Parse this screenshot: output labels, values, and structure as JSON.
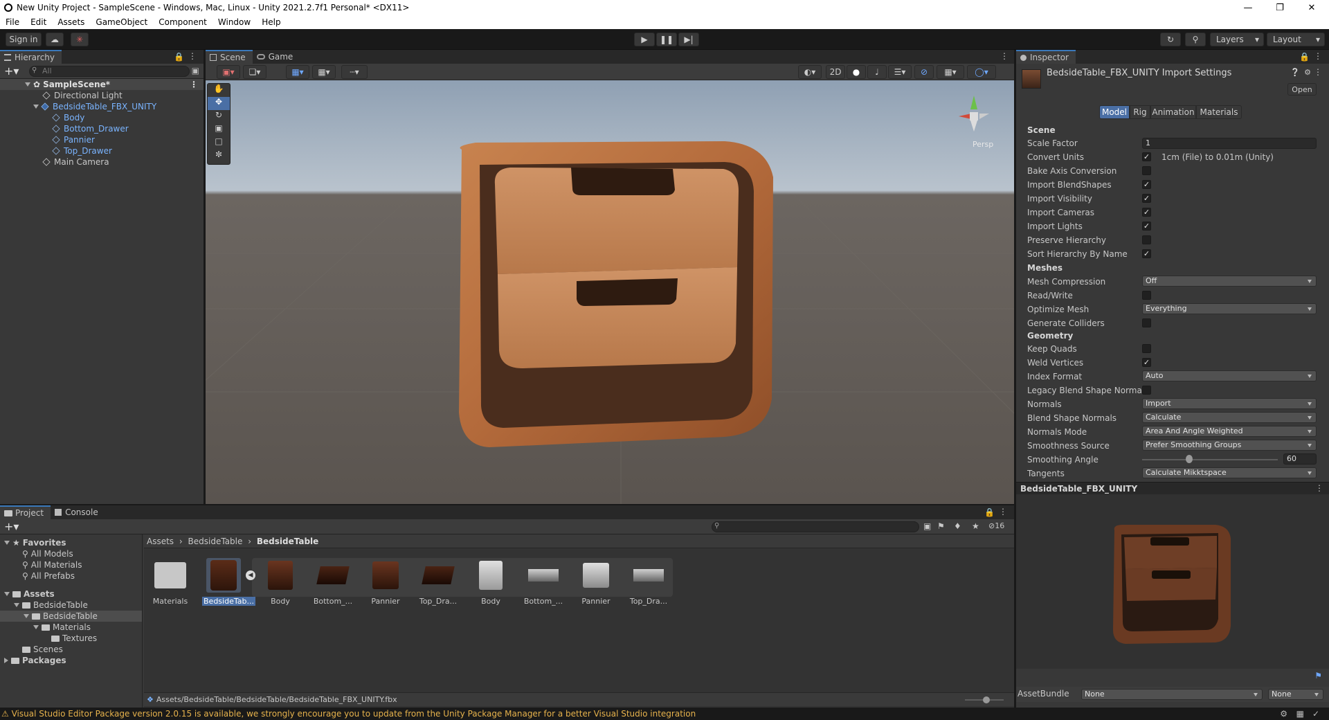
{
  "window": {
    "title": "New Unity Project - SampleScene - Windows, Mac, Linux - Unity 2021.2.7f1 Personal* <DX11>"
  },
  "menu": [
    "File",
    "Edit",
    "Assets",
    "GameObject",
    "Component",
    "Window",
    "Help"
  ],
  "toolbar": {
    "sign_in": "Sign in",
    "layers": "Layers",
    "layout": "Layout"
  },
  "hierarchy": {
    "tab": "Hierarchy",
    "search_placeholder": "All",
    "items": [
      "SampleScene*",
      "Directional Light",
      "BedsideTable_FBX_UNITY",
      "Body",
      "Bottom_Drawer",
      "Pannier",
      "Top_Drawer",
      "Main Camera"
    ]
  },
  "scene": {
    "tab_scene": "Scene",
    "tab_game": "Game",
    "btn_2d": "2D",
    "persp": "Persp"
  },
  "inspector": {
    "tab": "Inspector",
    "title": "BedsideTable_FBX_UNITY Import Settings",
    "open": "Open",
    "tabs": [
      "Model",
      "Rig",
      "Animation",
      "Materials"
    ],
    "scene_header": "Scene",
    "scale_factor_label": "Scale Factor",
    "scale_factor_value": "1",
    "convert_units_label": "Convert Units",
    "convert_units_note": "1cm (File) to 0.01m (Unity)",
    "bake_axis": "Bake Axis Conversion",
    "import_blendshapes": "Import BlendShapes",
    "import_visibility": "Import Visibility",
    "import_cameras": "Import Cameras",
    "import_lights": "Import Lights",
    "preserve_hierarchy": "Preserve Hierarchy",
    "sort_hierarchy": "Sort Hierarchy By Name",
    "meshes_header": "Meshes",
    "mesh_compression_label": "Mesh Compression",
    "mesh_compression_value": "Off",
    "read_write": "Read/Write",
    "optimize_mesh_label": "Optimize Mesh",
    "optimize_mesh_value": "Everything",
    "generate_colliders": "Generate Colliders",
    "geometry_header": "Geometry",
    "keep_quads": "Keep Quads",
    "weld_vertices": "Weld Vertices",
    "index_format_label": "Index Format",
    "index_format_value": "Auto",
    "legacy_blend": "Legacy Blend Shape Normals",
    "normals_label": "Normals",
    "normals_value": "Import",
    "blend_normals_label": "Blend Shape Normals",
    "blend_normals_value": "Calculate",
    "normals_mode_label": "Normals Mode",
    "normals_mode_value": "Area And Angle Weighted",
    "smoothness_source_label": "Smoothness Source",
    "smoothness_source_value": "Prefer Smoothing Groups",
    "smoothing_angle_label": "Smoothing Angle",
    "smoothing_angle_value": "60",
    "tangents_label": "Tangents",
    "tangents_value": "Calculate Mikktspace",
    "preview_title": "BedsideTable_FBX_UNITY",
    "assetbundle_label": "AssetBundle",
    "assetbundle_value": "None",
    "assetbundle_variant": "None"
  },
  "project": {
    "tab_project": "Project",
    "tab_console": "Console",
    "favorites": "Favorites",
    "fav_items": [
      "All Models",
      "All Materials",
      "All Prefabs"
    ],
    "tree": [
      "Assets",
      "BedsideTable",
      "BedsideTable",
      "Materials",
      "Textures",
      "Scenes",
      "Packages"
    ],
    "breadcrumb": [
      "Assets",
      "BedsideTable",
      "BedsideTable"
    ],
    "hidden_count": "16",
    "assets": [
      "Materials",
      "BedsideTab...",
      "Body",
      "Bottom_...",
      "Pannier",
      "Top_Dra...",
      "Body",
      "Bottom_...",
      "Pannier",
      "Top_Dra..."
    ],
    "path": "Assets/BedsideTable/BedsideTable/BedsideTable_FBX_UNITY.fbx"
  },
  "status": {
    "message": "Visual Studio Editor Package version 2.0.15 is available, we strongly encourage you to update from the Unity Package Manager for a better Visual Studio integration"
  }
}
